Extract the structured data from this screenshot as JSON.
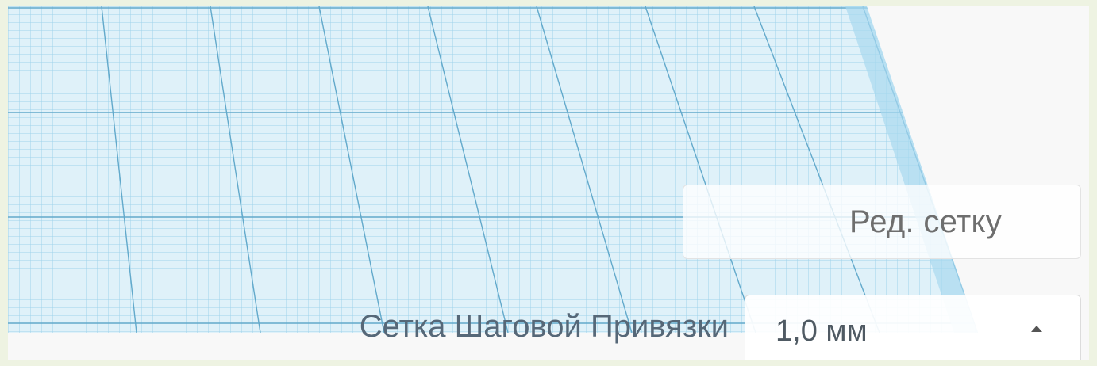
{
  "workplane": {
    "grid_color": "#8fcbe8",
    "major_line_color": "#5ea7c9",
    "fill_color": "#d9eef8"
  },
  "edit_grid": {
    "label": "Ред. сетку"
  },
  "snap_grid": {
    "label": "Сетка Шаговой Привязки",
    "value": "1,0 мм",
    "caret_icon": "caret-up-icon"
  }
}
